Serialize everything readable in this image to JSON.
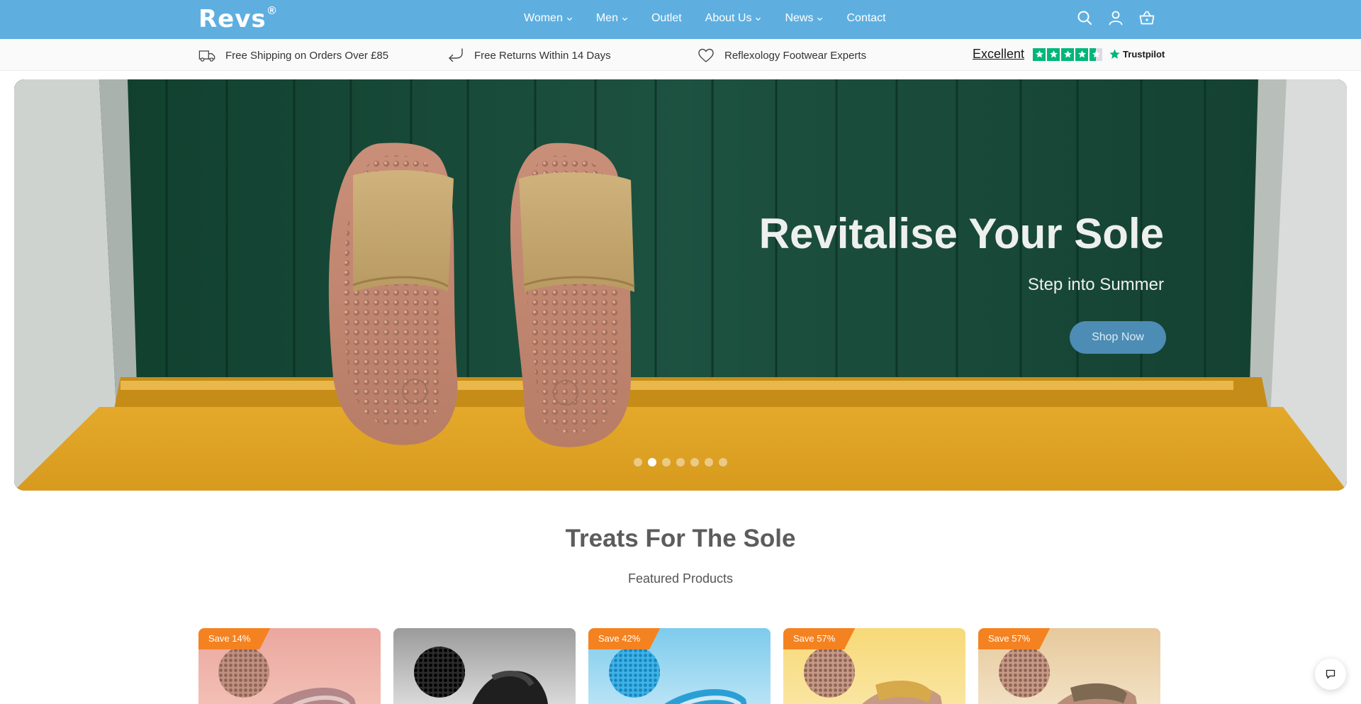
{
  "header": {
    "logo_text": "Revs",
    "logo_mark": "®",
    "nav": [
      {
        "label": "Women",
        "has_dropdown": true
      },
      {
        "label": "Men",
        "has_dropdown": true
      },
      {
        "label": "Outlet",
        "has_dropdown": false
      },
      {
        "label": "About Us",
        "has_dropdown": true
      },
      {
        "label": "News",
        "has_dropdown": true
      },
      {
        "label": "Contact",
        "has_dropdown": false
      }
    ],
    "icons": [
      "search-icon",
      "account-icon",
      "basket-icon"
    ],
    "background_color": "#5eafe0"
  },
  "usp_bar": {
    "items": [
      {
        "icon": "delivery-truck-icon",
        "text": "Free Shipping on Orders Over £85"
      },
      {
        "icon": "return-arrow-icon",
        "text": "Free Returns Within 14 Days"
      },
      {
        "icon": "heart-icon",
        "text": "Reflexology Footwear Experts"
      }
    ],
    "trustpilot": {
      "rating_text": "Excellent",
      "brand": "Trustpilot",
      "stars": 4.5,
      "star_color": "#00b67a"
    }
  },
  "hero": {
    "title": "Revitalise Your Sole",
    "subtitle": "Step into Summer",
    "button_label": "Shop Now",
    "slide_count": 7,
    "active_slide": 2,
    "button_color": "#4d8cb4"
  },
  "featured": {
    "title": "Treats For The Sole",
    "subtitle": "Featured Products",
    "products": [
      {
        "badge": "Save 14%",
        "bg": "pink"
      },
      {
        "badge": "",
        "bg": "grey"
      },
      {
        "badge": "Save 42%",
        "bg": "light-blue"
      },
      {
        "badge": "Save 57%",
        "bg": "yellow"
      },
      {
        "badge": "Save 57%",
        "bg": "beige"
      }
    ],
    "badge_color": "#f58220"
  },
  "chat": {
    "icon": "chat-bubble-icon"
  }
}
